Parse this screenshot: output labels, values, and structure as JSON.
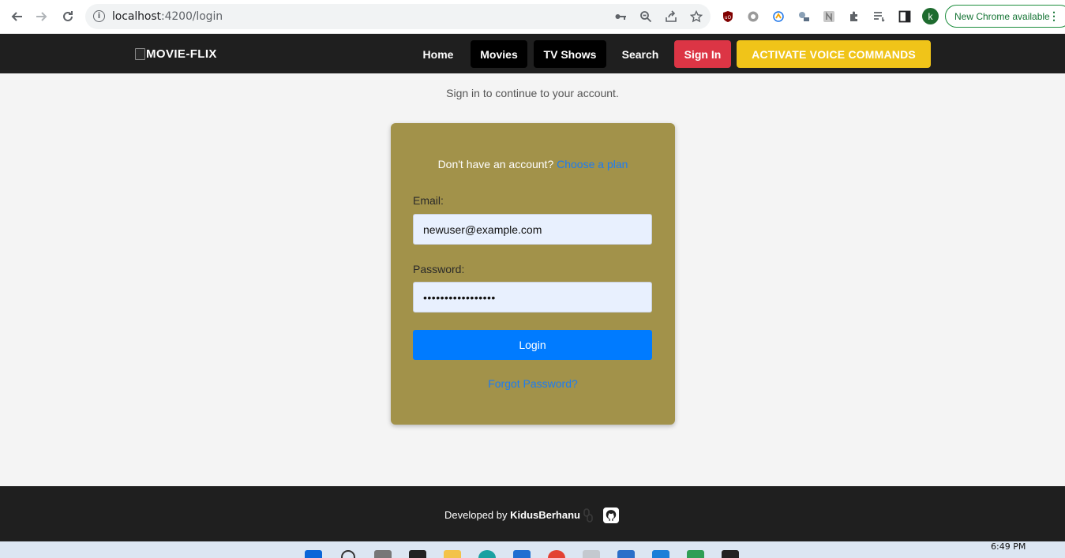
{
  "browser": {
    "url_host": "localhost",
    "url_rest": ":4200/login",
    "update_label": "New Chrome available",
    "profile_initial": "k"
  },
  "header": {
    "logo_text": "MOVIE-FLIX",
    "nav": {
      "home": "Home",
      "movies": "Movies",
      "tv_shows": "TV Shows",
      "search": "Search",
      "sign_in": "Sign In",
      "voice": "ACTIVATE VOICE COMMANDS"
    }
  },
  "main": {
    "subtitle": "Sign in to continue to your account.",
    "prompt": "Don't have an account?",
    "prompt_link": "Choose a plan",
    "email_label": "Email:",
    "email_value": "newuser@example.com",
    "password_label": "Password:",
    "password_value": "•••••••••••••••••",
    "login_label": "Login",
    "forgot_label": "Forgot Password?"
  },
  "footer": {
    "prefix": "Developed by",
    "author": "KidusBerhanu"
  },
  "taskbar": {
    "time": "6:49 PM"
  },
  "colors": {
    "header_bg": "#1f1f1f",
    "card_bg": "#a2924a",
    "signin_bg": "#dc3545",
    "voice_bg": "#f0c419",
    "login_bg": "#007bff",
    "link": "#1d7cf2",
    "input_bg": "#e8f0fe"
  },
  "icons": [
    "back-arrow-icon",
    "forward-arrow-icon",
    "reload-icon",
    "info-icon",
    "key-icon",
    "zoom-icon",
    "share-icon",
    "star-icon",
    "ublock-icon",
    "extension-icon",
    "puzzle-icon",
    "reading-list-icon",
    "side-panel-icon",
    "kebab-menu-icon",
    "link-icon",
    "github-icon"
  ]
}
